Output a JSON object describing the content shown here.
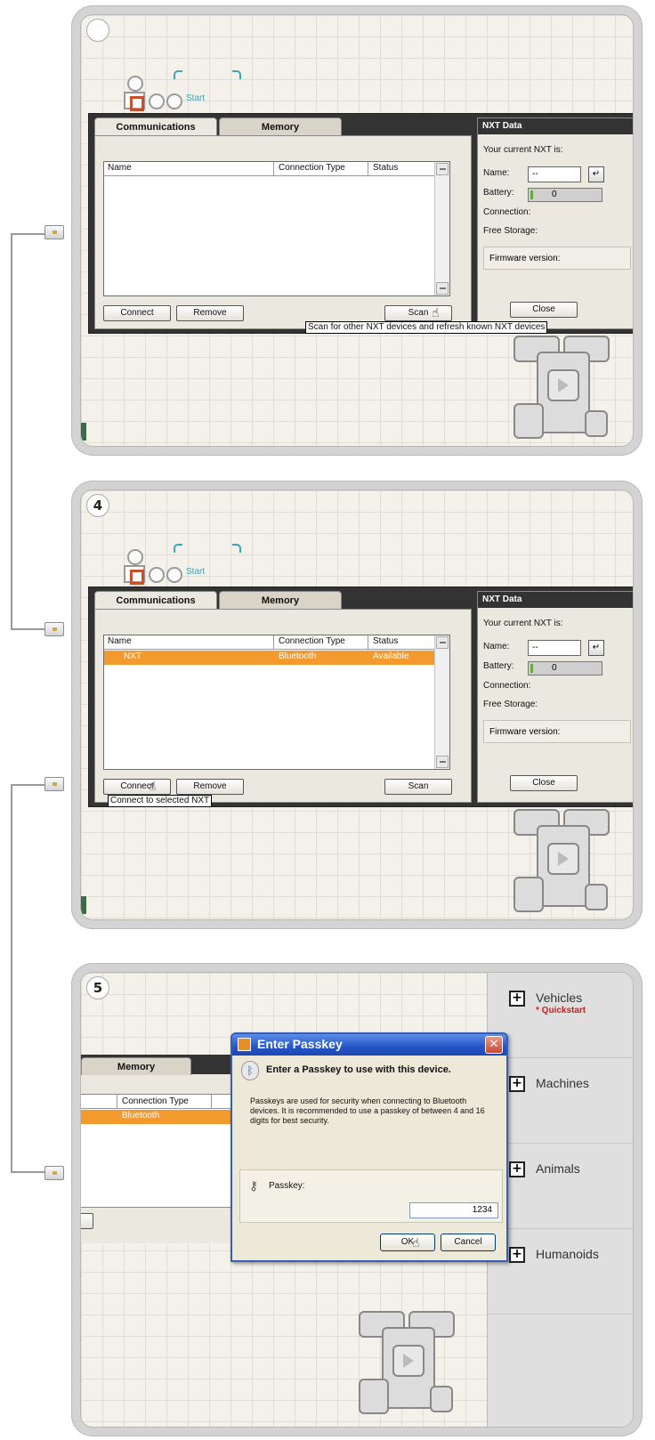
{
  "panels": [
    {
      "step": "",
      "tabs": {
        "communications": "Communications",
        "memory": "Memory"
      },
      "columns": {
        "name": "Name",
        "type": "Connection Type",
        "status": "Status"
      },
      "rows": [],
      "buttons": {
        "connect": "Connect",
        "remove": "Remove",
        "scan": "Scan",
        "close": "Close"
      },
      "nxt": {
        "header": "NXT Data",
        "current": "Your current NXT is:",
        "name_label": "Name:",
        "name_value": "--",
        "battery_label": "Battery:",
        "battery_value": "0",
        "connection_label": "Connection:",
        "storage_label": "Free Storage:",
        "firmware_label": "Firmware version:"
      },
      "start_label": "Start",
      "tooltip": "Scan for other NXT devices and refresh known NXT devices"
    },
    {
      "step": "4",
      "tabs": {
        "communications": "Communications",
        "memory": "Memory"
      },
      "columns": {
        "name": "Name",
        "type": "Connection Type",
        "status": "Status"
      },
      "rows": [
        {
          "name": "NXT",
          "type": "Bluetooth",
          "status": "Available"
        }
      ],
      "buttons": {
        "connect": "Connect",
        "remove": "Remove",
        "scan": "Scan",
        "close": "Close"
      },
      "nxt": {
        "header": "NXT Data",
        "current": "Your current NXT is:",
        "name_label": "Name:",
        "name_value": "--",
        "battery_label": "Battery:",
        "battery_value": "0",
        "connection_label": "Connection:",
        "storage_label": "Free Storage:",
        "firmware_label": "Firmware version:"
      },
      "start_label": "Start",
      "tooltip": "Connect to selected NXT"
    },
    {
      "step": "5",
      "memory_tab": "Memory",
      "column_type": "Connection Type",
      "row_type": "Bluetooth",
      "categories": [
        {
          "label": "Vehicles",
          "sub": "* Quickstart"
        },
        {
          "label": "Machines",
          "sub": ""
        },
        {
          "label": "Animals",
          "sub": ""
        },
        {
          "label": "Humanoids",
          "sub": ""
        }
      ],
      "dialog": {
        "title": "Enter Passkey",
        "heading": "Enter a Passkey to use with this device.",
        "body": "Passkeys are used for security when connecting to Bluetooth devices. It is recommended to use a passkey of between 4 and 16 digits for best security.",
        "passkey_label": "Passkey:",
        "passkey_value": "1234",
        "ok": "OK",
        "cancel": "Cancel"
      }
    }
  ],
  "colors": {
    "selection": "#f29a2e",
    "accent": "#3aa7b5",
    "title_bar": "#2455c7"
  },
  "icons": [
    "hand-cursor-icon",
    "bluetooth-icon",
    "key-icon",
    "close-icon",
    "enter-icon",
    "plus-icon",
    "play-icon"
  ]
}
